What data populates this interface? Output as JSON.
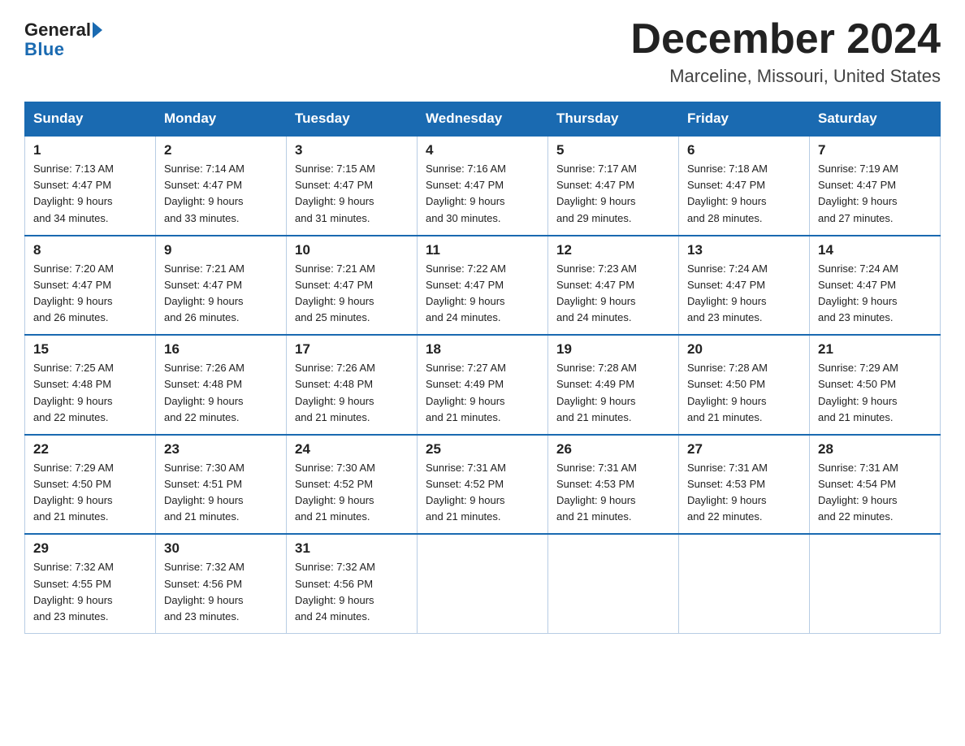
{
  "header": {
    "logo_general": "General",
    "logo_blue": "Blue",
    "month_title": "December 2024",
    "location": "Marceline, Missouri, United States"
  },
  "weekdays": [
    "Sunday",
    "Monday",
    "Tuesday",
    "Wednesday",
    "Thursday",
    "Friday",
    "Saturday"
  ],
  "weeks": [
    [
      {
        "day": "1",
        "sunrise": "7:13 AM",
        "sunset": "4:47 PM",
        "daylight": "9 hours and 34 minutes."
      },
      {
        "day": "2",
        "sunrise": "7:14 AM",
        "sunset": "4:47 PM",
        "daylight": "9 hours and 33 minutes."
      },
      {
        "day": "3",
        "sunrise": "7:15 AM",
        "sunset": "4:47 PM",
        "daylight": "9 hours and 31 minutes."
      },
      {
        "day": "4",
        "sunrise": "7:16 AM",
        "sunset": "4:47 PM",
        "daylight": "9 hours and 30 minutes."
      },
      {
        "day": "5",
        "sunrise": "7:17 AM",
        "sunset": "4:47 PM",
        "daylight": "9 hours and 29 minutes."
      },
      {
        "day": "6",
        "sunrise": "7:18 AM",
        "sunset": "4:47 PM",
        "daylight": "9 hours and 28 minutes."
      },
      {
        "day": "7",
        "sunrise": "7:19 AM",
        "sunset": "4:47 PM",
        "daylight": "9 hours and 27 minutes."
      }
    ],
    [
      {
        "day": "8",
        "sunrise": "7:20 AM",
        "sunset": "4:47 PM",
        "daylight": "9 hours and 26 minutes."
      },
      {
        "day": "9",
        "sunrise": "7:21 AM",
        "sunset": "4:47 PM",
        "daylight": "9 hours and 26 minutes."
      },
      {
        "day": "10",
        "sunrise": "7:21 AM",
        "sunset": "4:47 PM",
        "daylight": "9 hours and 25 minutes."
      },
      {
        "day": "11",
        "sunrise": "7:22 AM",
        "sunset": "4:47 PM",
        "daylight": "9 hours and 24 minutes."
      },
      {
        "day": "12",
        "sunrise": "7:23 AM",
        "sunset": "4:47 PM",
        "daylight": "9 hours and 24 minutes."
      },
      {
        "day": "13",
        "sunrise": "7:24 AM",
        "sunset": "4:47 PM",
        "daylight": "9 hours and 23 minutes."
      },
      {
        "day": "14",
        "sunrise": "7:24 AM",
        "sunset": "4:47 PM",
        "daylight": "9 hours and 23 minutes."
      }
    ],
    [
      {
        "day": "15",
        "sunrise": "7:25 AM",
        "sunset": "4:48 PM",
        "daylight": "9 hours and 22 minutes."
      },
      {
        "day": "16",
        "sunrise": "7:26 AM",
        "sunset": "4:48 PM",
        "daylight": "9 hours and 22 minutes."
      },
      {
        "day": "17",
        "sunrise": "7:26 AM",
        "sunset": "4:48 PM",
        "daylight": "9 hours and 21 minutes."
      },
      {
        "day": "18",
        "sunrise": "7:27 AM",
        "sunset": "4:49 PM",
        "daylight": "9 hours and 21 minutes."
      },
      {
        "day": "19",
        "sunrise": "7:28 AM",
        "sunset": "4:49 PM",
        "daylight": "9 hours and 21 minutes."
      },
      {
        "day": "20",
        "sunrise": "7:28 AM",
        "sunset": "4:50 PM",
        "daylight": "9 hours and 21 minutes."
      },
      {
        "day": "21",
        "sunrise": "7:29 AM",
        "sunset": "4:50 PM",
        "daylight": "9 hours and 21 minutes."
      }
    ],
    [
      {
        "day": "22",
        "sunrise": "7:29 AM",
        "sunset": "4:50 PM",
        "daylight": "9 hours and 21 minutes."
      },
      {
        "day": "23",
        "sunrise": "7:30 AM",
        "sunset": "4:51 PM",
        "daylight": "9 hours and 21 minutes."
      },
      {
        "day": "24",
        "sunrise": "7:30 AM",
        "sunset": "4:52 PM",
        "daylight": "9 hours and 21 minutes."
      },
      {
        "day": "25",
        "sunrise": "7:31 AM",
        "sunset": "4:52 PM",
        "daylight": "9 hours and 21 minutes."
      },
      {
        "day": "26",
        "sunrise": "7:31 AM",
        "sunset": "4:53 PM",
        "daylight": "9 hours and 21 minutes."
      },
      {
        "day": "27",
        "sunrise": "7:31 AM",
        "sunset": "4:53 PM",
        "daylight": "9 hours and 22 minutes."
      },
      {
        "day": "28",
        "sunrise": "7:31 AM",
        "sunset": "4:54 PM",
        "daylight": "9 hours and 22 minutes."
      }
    ],
    [
      {
        "day": "29",
        "sunrise": "7:32 AM",
        "sunset": "4:55 PM",
        "daylight": "9 hours and 23 minutes."
      },
      {
        "day": "30",
        "sunrise": "7:32 AM",
        "sunset": "4:56 PM",
        "daylight": "9 hours and 23 minutes."
      },
      {
        "day": "31",
        "sunrise": "7:32 AM",
        "sunset": "4:56 PM",
        "daylight": "9 hours and 24 minutes."
      },
      null,
      null,
      null,
      null
    ]
  ],
  "labels": {
    "sunrise": "Sunrise:",
    "sunset": "Sunset:",
    "daylight": "Daylight:"
  }
}
